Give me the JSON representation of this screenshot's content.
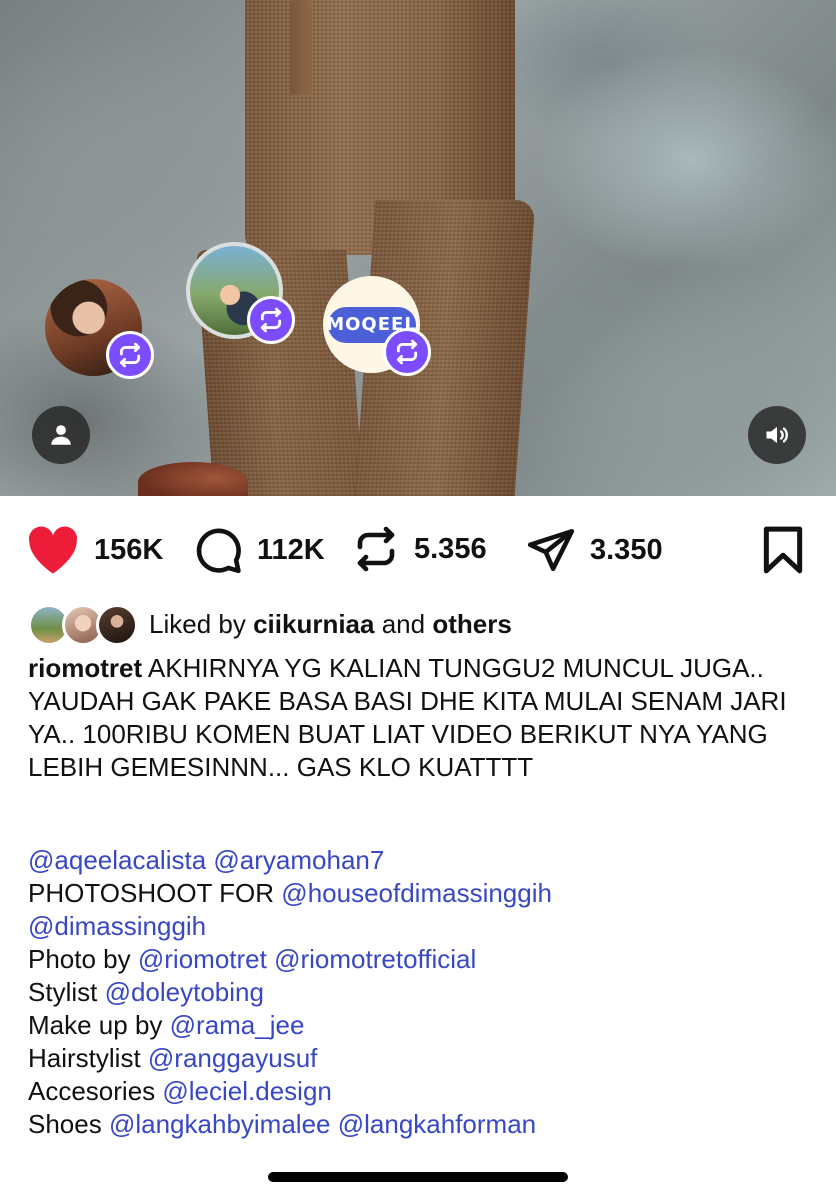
{
  "media": {
    "avatars": [
      {
        "name": "reposter-avatar-woman"
      },
      {
        "name": "reposter-avatar-child"
      },
      {
        "name": "reposter-avatar-moqeel",
        "logo_text": "MOQEEL"
      }
    ],
    "icons": {
      "user": "person-icon",
      "sound": "speaker-icon",
      "repost": "repost-icon"
    }
  },
  "actions": {
    "likes": "156K",
    "comments": "112K",
    "reposts": "5.356",
    "shares": "3.350",
    "like_color": "#ed1d3a"
  },
  "liked_by": {
    "prefix": "Liked by",
    "user": "ciikurniaa",
    "and": "and",
    "others": "others"
  },
  "caption": {
    "username": "riomotret",
    "line1": "AKHIRNYA YG KALIAN TUNGGU2 MUNCUL JUGA..",
    "line2": "YAUDAH GAK PAKE BASA BASI DHE KITA MULAI SENAM JARI YA.. 100RIBU KOMEN BUAT LIAT VIDEO BERIKUT NYA YANG LEBIH GEMESINNN... GAS KLO KUATTTT",
    "mention_aqeela": "@aqeelacalista",
    "mention_arya": "@aryamohan7",
    "photoshoot_label": "PHOTOSHOOT FOR",
    "mention_house": "@houseofdimassinggih",
    "mention_dimas": "@dimassinggih",
    "photo_label": "Photo by",
    "mention_rio": "@riomotret",
    "mention_rio_official": "@riomotretofficial",
    "stylist_label": "Stylist",
    "mention_stylist": "@doleytobing",
    "makeup_label": "Make up by",
    "mention_makeup": "@rama_jee",
    "hair_label": "Hairstylist",
    "mention_hair": "@ranggayusuf",
    "accessories_label": "Accesories",
    "mention_accessories": "@leciel.design",
    "shoes_label": "Shoes",
    "mention_shoes_1": "@langkahbyimalee",
    "mention_shoes_2": "@langkahforman",
    "mention_color": "#3848c4"
  }
}
